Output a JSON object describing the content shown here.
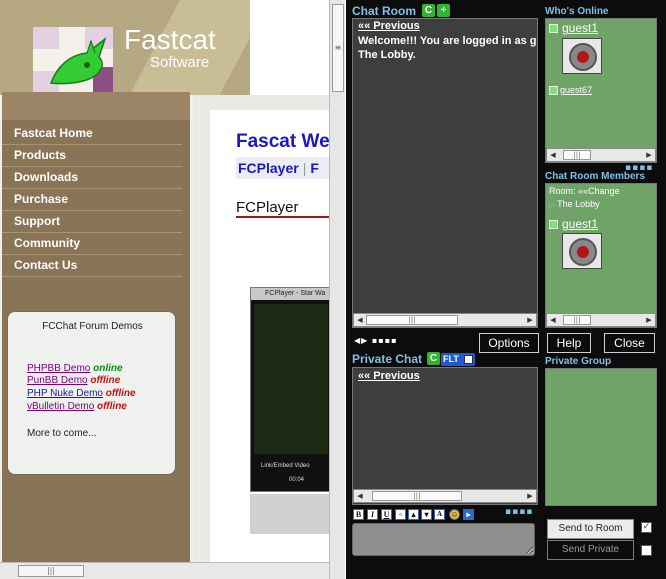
{
  "site": {
    "title": "Fastcat",
    "subtitle": "Software",
    "nav": [
      "Fastcat Home",
      "Products",
      "Downloads",
      "Purchase",
      "Support",
      "Community",
      "Contact Us"
    ],
    "forum_box": {
      "title": "FCChat Forum Demos",
      "demos": [
        {
          "name": "PHPBB Demo",
          "status": "online"
        },
        {
          "name": "PunBB Demo",
          "status": "offline"
        },
        {
          "name": "PHP Nuke Demo",
          "status": "offline"
        },
        {
          "name": "vBulletin Demo",
          "status": "offline"
        }
      ],
      "more": "More to come..."
    },
    "content": {
      "title": "Fascat We",
      "tab1": "FCPlayer",
      "tab_sep": "|",
      "tab2": "F",
      "heading": "FCPlayer",
      "player_title": "FCPlayer - Star Wa",
      "player_ctrl_label": "Link/Embed   Video",
      "player_time": "00:04"
    }
  },
  "chat": {
    "chat_room_label": "Chat Room",
    "chat_room_btn1": "C",
    "chat_room_btn2": "+",
    "previous_link": "«« Previous",
    "welcome_line1": "Welcome!!! You are logged in as g",
    "welcome_line2": "The Lobby.",
    "whos_online_label": "Who's Online",
    "online_users": [
      "guest1",
      "guest67"
    ],
    "members_label": "Chat Room Members",
    "room_prefix": "Room:",
    "room_change": "««Change",
    "room_name": "The Lobby",
    "members": [
      "guest1"
    ],
    "buttons": {
      "options": "Options",
      "help": "Help",
      "close": "Close"
    },
    "private_chat_label": "Private Chat",
    "private_chat_btn": "C",
    "flt_label": "FLT",
    "private_previous": "«« Previous",
    "private_group_label": "Private Group",
    "format_buttons": [
      "B",
      "I",
      "U",
      "",
      "",
      "",
      "A",
      "",
      ""
    ],
    "send_room": "Send to Room",
    "send_private": "Send Private",
    "send_room_checked": true,
    "send_private_checked": false,
    "message_value": ""
  },
  "colors": {
    "chat_bg": "#0c0c0c",
    "chat_label": "#7ec0e6",
    "green_panel": "#6fa367",
    "dark_panel": "#3e3e3e",
    "site_header": "#b5a882",
    "nav_panel": "#8a7458",
    "content_title": "#1818c8"
  }
}
